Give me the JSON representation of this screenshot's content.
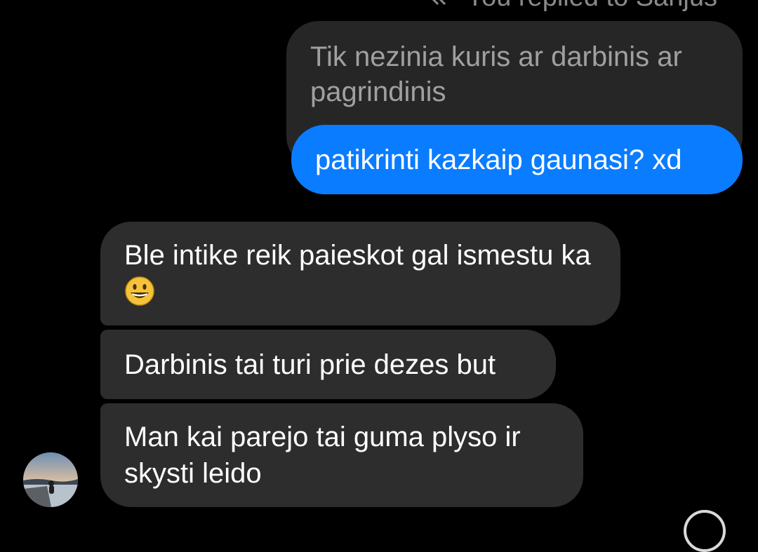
{
  "reply_header": {
    "text": "You replied to Sanjus",
    "icon": "reply-arrow-icon"
  },
  "quoted_message": {
    "text": "Tik nezinia kuris ar darbinis ar pagrindinis"
  },
  "sent_message": {
    "text": "patikrinti kazkaip gaunasi? xd"
  },
  "received_messages": [
    {
      "text": "Ble intike reik paieskot gal ismestu ka",
      "emoji": "grinning-face-emoji"
    },
    {
      "text": "Darbinis tai turi prie dezes but"
    },
    {
      "text": "Man kai parejo tai guma plyso ir skysti leido"
    }
  ],
  "colors": {
    "background": "#000000",
    "sent_bubble": "#0a7cff",
    "received_bubble": "#2d2d2d",
    "quoted_bubble": "#262626"
  }
}
